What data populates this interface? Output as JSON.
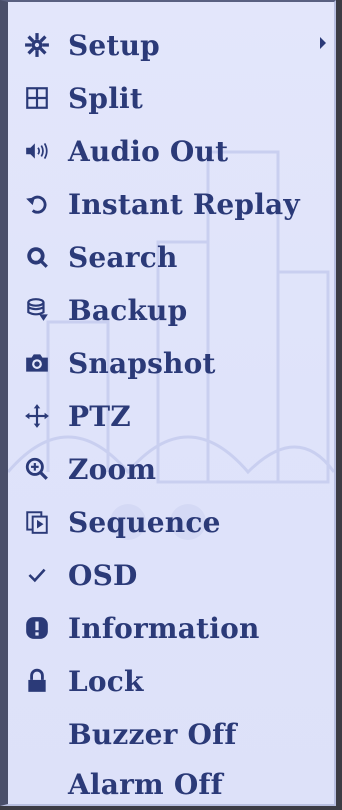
{
  "menu": {
    "items": [
      {
        "label": "Setup",
        "icon": "gear-icon",
        "has_submenu": true
      },
      {
        "label": "Split",
        "icon": "grid-split-icon"
      },
      {
        "label": "Audio Out",
        "icon": "speaker-icon"
      },
      {
        "label": "Instant Replay",
        "icon": "replay-icon"
      },
      {
        "label": "Search",
        "icon": "search-icon"
      },
      {
        "label": "Backup",
        "icon": "backup-icon"
      },
      {
        "label": "Snapshot",
        "icon": "camera-icon"
      },
      {
        "label": "PTZ",
        "icon": "move-arrows-icon"
      },
      {
        "label": "Zoom",
        "icon": "zoom-in-icon"
      },
      {
        "label": "Sequence",
        "icon": "sequence-icon"
      },
      {
        "label": "OSD",
        "icon": "checkmark-icon",
        "checked": true
      },
      {
        "label": "Information",
        "icon": "info-icon"
      },
      {
        "label": "Lock",
        "icon": "lock-icon"
      },
      {
        "label": "Buzzer Off",
        "icon": ""
      },
      {
        "label": "Alarm Off",
        "icon": ""
      }
    ]
  },
  "colors": {
    "text": "#2b3a78",
    "background": "#e3e6fb",
    "border": "#4a4f6a"
  }
}
